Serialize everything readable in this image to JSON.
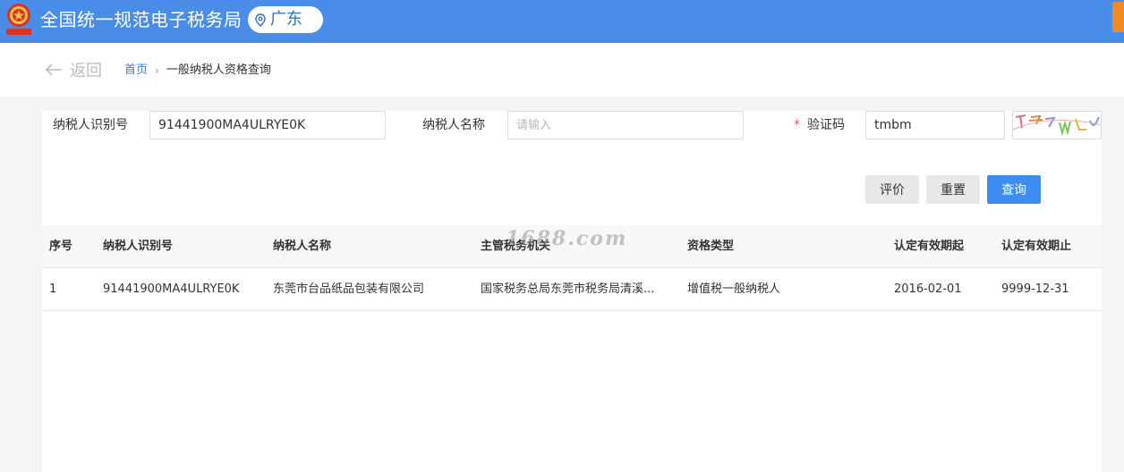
{
  "header": {
    "title": "全国统一规范电子税务局",
    "region": "广东",
    "brand_color": "#4a8de8",
    "emblem_icon": "tax-emblem-icon",
    "location_icon": "location-pin-icon"
  },
  "nav": {
    "back_label": "返回",
    "breadcrumb": {
      "home": "首页",
      "separator": "›",
      "current": "一般纳税人资格查询"
    }
  },
  "form": {
    "taxpayer_id": {
      "label": "纳税人识别号",
      "value": "91441900MA4ULRYE0K"
    },
    "taxpayer_name": {
      "label": "纳税人名称",
      "placeholder": "请输入"
    },
    "captcha": {
      "required_mark": "*",
      "label": "验证码",
      "value": "tmbm"
    }
  },
  "buttons": {
    "evaluate": "评价",
    "reset": "重置",
    "query": "查询",
    "query_color": "#3f8cf0"
  },
  "table": {
    "headers": [
      "序号",
      "纳税人识别号",
      "纳税人名称",
      "主管税务机关",
      "资格类型",
      "认定有效期起",
      "认定有效期止"
    ],
    "rows": [
      [
        "1",
        "91441900MA4ULRYE0K",
        "东莞市台品纸品包装有限公司",
        "国家税务总局东莞市税务局清溪...",
        "增值税一般纳税人",
        "2016-02-01",
        "9999-12-31"
      ]
    ]
  },
  "watermark": "1688.com"
}
